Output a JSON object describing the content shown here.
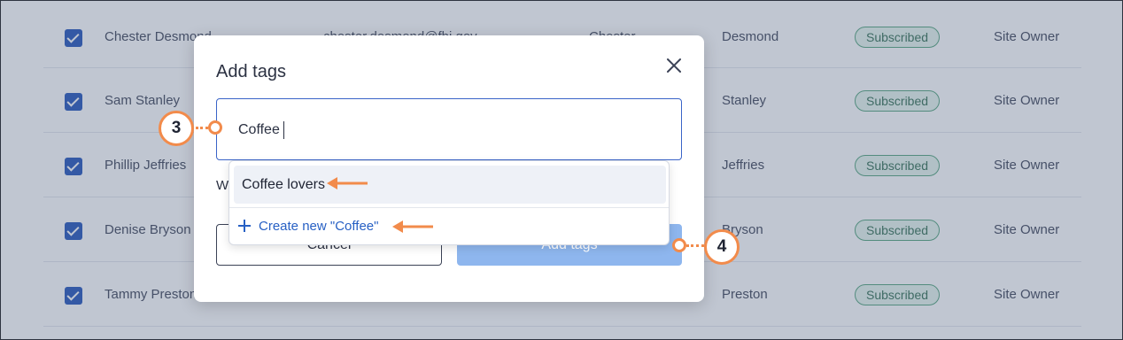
{
  "contacts": {
    "rows": [
      {
        "name": "Chester Desmond",
        "email": "chester.desmond@fbi.gov",
        "first": "Chester",
        "last": "Desmond",
        "status": "Subscribed",
        "role": "Site Owner"
      },
      {
        "name": "Sam Stanley",
        "email": "",
        "first": "",
        "last": "Stanley",
        "status": "Subscribed",
        "role": "Site Owner"
      },
      {
        "name": "Phillip Jeffries",
        "email": "",
        "first": "",
        "last": "Jeffries",
        "status": "Subscribed",
        "role": "Site Owner"
      },
      {
        "name": "Denise Bryson",
        "email": "",
        "first": "",
        "last": "Bryson",
        "status": "Subscribed",
        "role": "Site Owner"
      },
      {
        "name": "Tammy Preston",
        "email": "",
        "first": "",
        "last": "Preston",
        "status": "Subscribed",
        "role": "Site Owner"
      }
    ]
  },
  "modal": {
    "title": "Add tags",
    "input_value": "Coffee",
    "hidden_label": "W",
    "cancel_label": "Cancel",
    "add_label": "Add tags"
  },
  "dropdown": {
    "option_label": "Coffee lovers",
    "create_label": "Create new \"Coffee\""
  },
  "callouts": {
    "step3": "3",
    "step4": "4"
  },
  "colors": {
    "accent": "#f28b4b",
    "primary": "#2760c4",
    "badge": "#4fa27a"
  }
}
